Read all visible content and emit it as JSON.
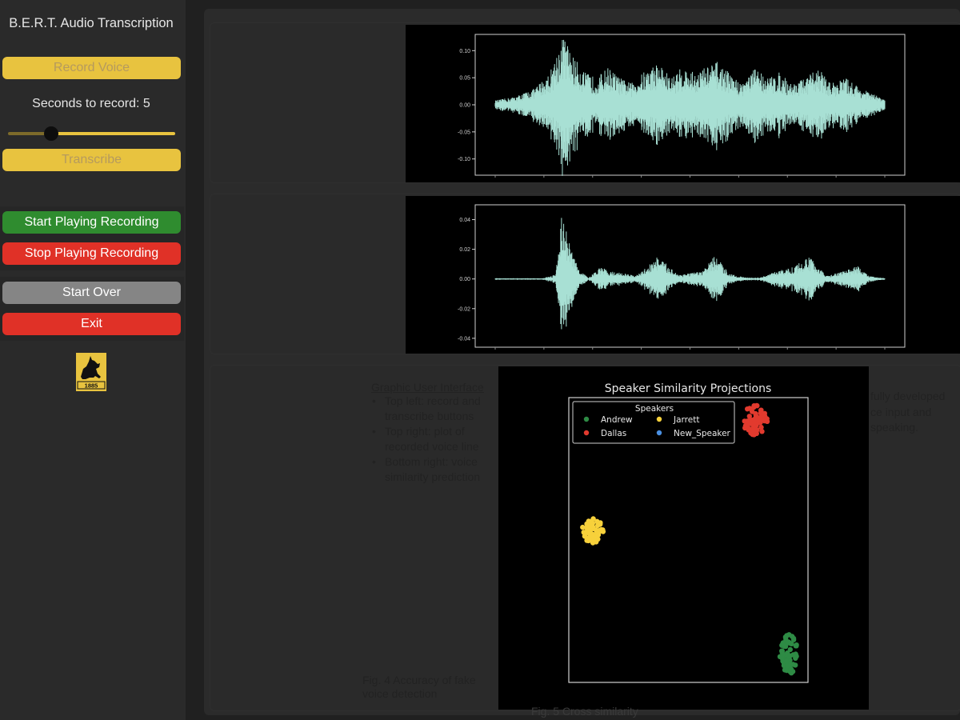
{
  "sidebar": {
    "title": "B.E.R.T. Audio Transcription",
    "record_label": "Record Voice",
    "seconds_label": "Seconds to record: 5",
    "seconds_value": 5,
    "transcribe_label": "Transcribe",
    "start_playing_label": "Start Playing Recording",
    "stop_playing_label": "Stop Playing Recording",
    "start_over_label": "Start Over",
    "exit_label": "Exit",
    "logo_year": "1885"
  },
  "colors": {
    "accent_yellow": "#e8c33f",
    "play_green": "#2f8c2f",
    "stop_red": "#e03127",
    "neutral_gray": "#858585",
    "waveform": "#a8e0d4",
    "andrew": "#2e8b45",
    "dallas": "#e23a2e",
    "jarrett": "#f7d13b",
    "new_speaker": "#4a90e2"
  },
  "poster": {
    "gui_heading": "Graphic User Interface",
    "gui_bullets": [
      "Top left: record and transcribe buttons",
      "Top right: plot of recorded voice line",
      "Bottom right: voice similarity prediction"
    ],
    "fig4_caption": "Fig. 4 Accuracy of fake voice detection",
    "fig5_caption": "Fig. 5 Cross similarity",
    "right_lines": [
      "fully developed",
      "ce input and",
      "speaking."
    ]
  },
  "chart_data": [
    {
      "type": "line",
      "title": "",
      "xlabel": "",
      "ylabel": "",
      "yticks": [
        "0.10",
        "0.05",
        "0.00",
        "-0.05",
        "-0.10"
      ],
      "ylim": [
        -0.13,
        0.13
      ],
      "description": "recorded voice waveform",
      "envelope": [
        {
          "t": 0.0,
          "a": 0.008
        },
        {
          "t": 0.05,
          "a": 0.015
        },
        {
          "t": 0.1,
          "a": 0.03
        },
        {
          "t": 0.14,
          "a": 0.06
        },
        {
          "t": 0.175,
          "a": 0.13
        },
        {
          "t": 0.2,
          "a": 0.09
        },
        {
          "t": 0.23,
          "a": 0.06
        },
        {
          "t": 0.26,
          "a": 0.05
        },
        {
          "t": 0.29,
          "a": 0.07
        },
        {
          "t": 0.32,
          "a": 0.05
        },
        {
          "t": 0.35,
          "a": 0.04
        },
        {
          "t": 0.38,
          "a": 0.06
        },
        {
          "t": 0.42,
          "a": 0.08
        },
        {
          "t": 0.45,
          "a": 0.05
        },
        {
          "t": 0.48,
          "a": 0.07
        },
        {
          "t": 0.51,
          "a": 0.06
        },
        {
          "t": 0.54,
          "a": 0.07
        },
        {
          "t": 0.57,
          "a": 0.08
        },
        {
          "t": 0.6,
          "a": 0.06
        },
        {
          "t": 0.63,
          "a": 0.04
        },
        {
          "t": 0.67,
          "a": 0.07
        },
        {
          "t": 0.7,
          "a": 0.05
        },
        {
          "t": 0.73,
          "a": 0.06
        },
        {
          "t": 0.76,
          "a": 0.04
        },
        {
          "t": 0.8,
          "a": 0.05
        },
        {
          "t": 0.83,
          "a": 0.07
        },
        {
          "t": 0.86,
          "a": 0.04
        },
        {
          "t": 0.9,
          "a": 0.05
        },
        {
          "t": 0.94,
          "a": 0.03
        },
        {
          "t": 0.97,
          "a": 0.02
        },
        {
          "t": 1.0,
          "a": 0.01
        }
      ]
    },
    {
      "type": "line",
      "title": "",
      "xlabel": "",
      "ylabel": "",
      "yticks": [
        "0.04",
        "0.02",
        "0.00",
        "-0.02",
        "-0.04"
      ],
      "ylim": [
        -0.046,
        0.05
      ],
      "description": "processed voice waveform",
      "envelope": [
        {
          "t": 0.0,
          "a": 0.0005
        },
        {
          "t": 0.12,
          "a": 0.0005
        },
        {
          "t": 0.155,
          "a": 0.003
        },
        {
          "t": 0.17,
          "a": 0.045
        },
        {
          "t": 0.19,
          "a": 0.025
        },
        {
          "t": 0.215,
          "a": 0.006
        },
        {
          "t": 0.24,
          "a": 0.0008
        },
        {
          "t": 0.27,
          "a": 0.008
        },
        {
          "t": 0.3,
          "a": 0.005
        },
        {
          "t": 0.33,
          "a": 0.004
        },
        {
          "t": 0.36,
          "a": 0.002
        },
        {
          "t": 0.38,
          "a": 0.006
        },
        {
          "t": 0.415,
          "a": 0.015
        },
        {
          "t": 0.44,
          "a": 0.01
        },
        {
          "t": 0.47,
          "a": 0.003
        },
        {
          "t": 0.5,
          "a": 0.004
        },
        {
          "t": 0.53,
          "a": 0.005
        },
        {
          "t": 0.565,
          "a": 0.016
        },
        {
          "t": 0.6,
          "a": 0.004
        },
        {
          "t": 0.64,
          "a": 0.001
        },
        {
          "t": 0.68,
          "a": 0.001
        },
        {
          "t": 0.72,
          "a": 0.005
        },
        {
          "t": 0.76,
          "a": 0.008
        },
        {
          "t": 0.81,
          "a": 0.015
        },
        {
          "t": 0.85,
          "a": 0.002
        },
        {
          "t": 0.89,
          "a": 0.005
        },
        {
          "t": 0.93,
          "a": 0.009
        },
        {
          "t": 0.96,
          "a": 0.002
        },
        {
          "t": 1.0,
          "a": 0.0005
        }
      ]
    },
    {
      "type": "scatter",
      "title": "Speaker Similarity Projections",
      "xlabel": "",
      "ylabel": "",
      "xlim": [
        0,
        100
      ],
      "ylim": [
        0,
        100
      ],
      "legend": {
        "title": "Speakers",
        "placement": "top-left",
        "entries": [
          "Andrew",
          "Dallas",
          "Jarrett",
          "New_Speaker"
        ]
      },
      "series": [
        {
          "name": "Andrew",
          "cx": 92,
          "cy": 10,
          "spread": 5,
          "points": 60
        },
        {
          "name": "Dallas",
          "cx": 78,
          "cy": 92,
          "spread": 7,
          "points": 60
        },
        {
          "name": "Jarrett",
          "cx": 10,
          "cy": 53,
          "spread": 6,
          "points": 60
        }
      ]
    }
  ]
}
